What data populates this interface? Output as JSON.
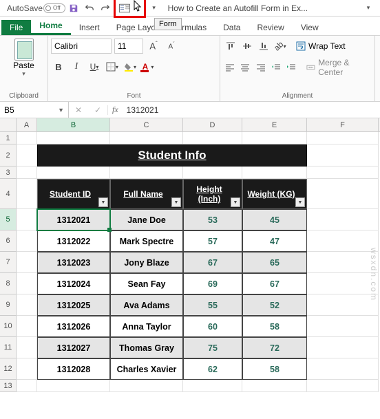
{
  "titlebar": {
    "autosave_label": "AutoSave",
    "autosave_state": "Off",
    "doc_title": "How to Create an Autofill Form in Ex...",
    "tooltip_form": "Form"
  },
  "tabs": {
    "file": "File",
    "items": [
      "Home",
      "Insert",
      "Page Layo",
      "Formulas",
      "Data",
      "Review",
      "View"
    ],
    "active": 0
  },
  "ribbon": {
    "clipboard": {
      "paste": "Paste",
      "label": "Clipboard"
    },
    "font": {
      "name": "Calibri",
      "size": "11",
      "bold": "B",
      "italic": "I",
      "underline": "U",
      "grow": "A",
      "shrink": "A",
      "label": "Font"
    },
    "align": {
      "wrap": "Wrap Text",
      "merge": "Merge & Center",
      "label": "Alignment"
    }
  },
  "formulabar": {
    "namebox": "B5",
    "fx": "fx",
    "value": "1312021"
  },
  "columns": [
    "A",
    "B",
    "C",
    "D",
    "E",
    "F"
  ],
  "title_cell": "Student Info",
  "headers": [
    "Student ID",
    "Full Name",
    "Height (Inch)",
    "Weight (KG)"
  ],
  "rows": [
    {
      "n": 1
    },
    {
      "n": 2
    },
    {
      "n": 3
    },
    {
      "n": 4
    },
    {
      "n": 5,
      "d": [
        "1312021",
        "Jane Doe",
        "53",
        "45"
      ]
    },
    {
      "n": 6,
      "d": [
        "1312022",
        "Mark Spectre",
        "57",
        "47"
      ]
    },
    {
      "n": 7,
      "d": [
        "1312023",
        "Jony Blaze",
        "67",
        "65"
      ]
    },
    {
      "n": 8,
      "d": [
        "1312024",
        "Sean Fay",
        "69",
        "67"
      ]
    },
    {
      "n": 9,
      "d": [
        "1312025",
        "Ava Adams",
        "55",
        "52"
      ]
    },
    {
      "n": 10,
      "d": [
        "1312026",
        "Anna Taylor",
        "60",
        "58"
      ]
    },
    {
      "n": 11,
      "d": [
        "1312027",
        "Thomas Gray",
        "75",
        "72"
      ]
    },
    {
      "n": 12,
      "d": [
        "1312028",
        "Charles Xavier",
        "62",
        "58"
      ]
    },
    {
      "n": 13
    }
  ],
  "watermark": "wsxdn.com"
}
